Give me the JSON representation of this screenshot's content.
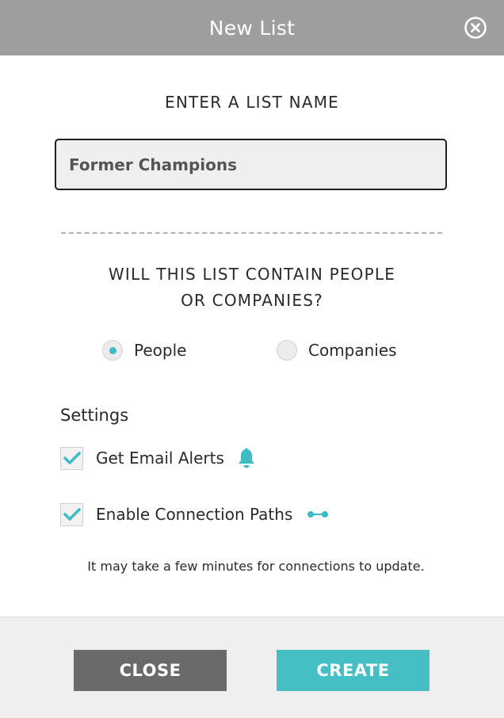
{
  "header": {
    "title": "New List",
    "close_icon": "close-circle-icon"
  },
  "name_section": {
    "label": "ENTER A LIST NAME",
    "input_value": "Former Champions"
  },
  "type_section": {
    "question_line1": "WILL THIS LIST CONTAIN PEOPLE",
    "question_line2": "OR COMPANIES?",
    "options": [
      {
        "label": "People",
        "selected": true
      },
      {
        "label": "Companies",
        "selected": false
      }
    ]
  },
  "settings": {
    "heading": "Settings",
    "items": [
      {
        "label": "Get Email Alerts",
        "checked": true,
        "icon": "bell-icon"
      },
      {
        "label": "Enable Connection Paths",
        "checked": true,
        "icon": "connection-path-icon"
      }
    ],
    "note": "It may take a few minutes for connections to update."
  },
  "footer": {
    "close_label": "CLOSE",
    "create_label": "CREATE"
  },
  "colors": {
    "header_bg": "#9e9e9e",
    "accent": "#45bec4",
    "close_button": "#6a6a6a",
    "footer_bg": "#efefef"
  }
}
